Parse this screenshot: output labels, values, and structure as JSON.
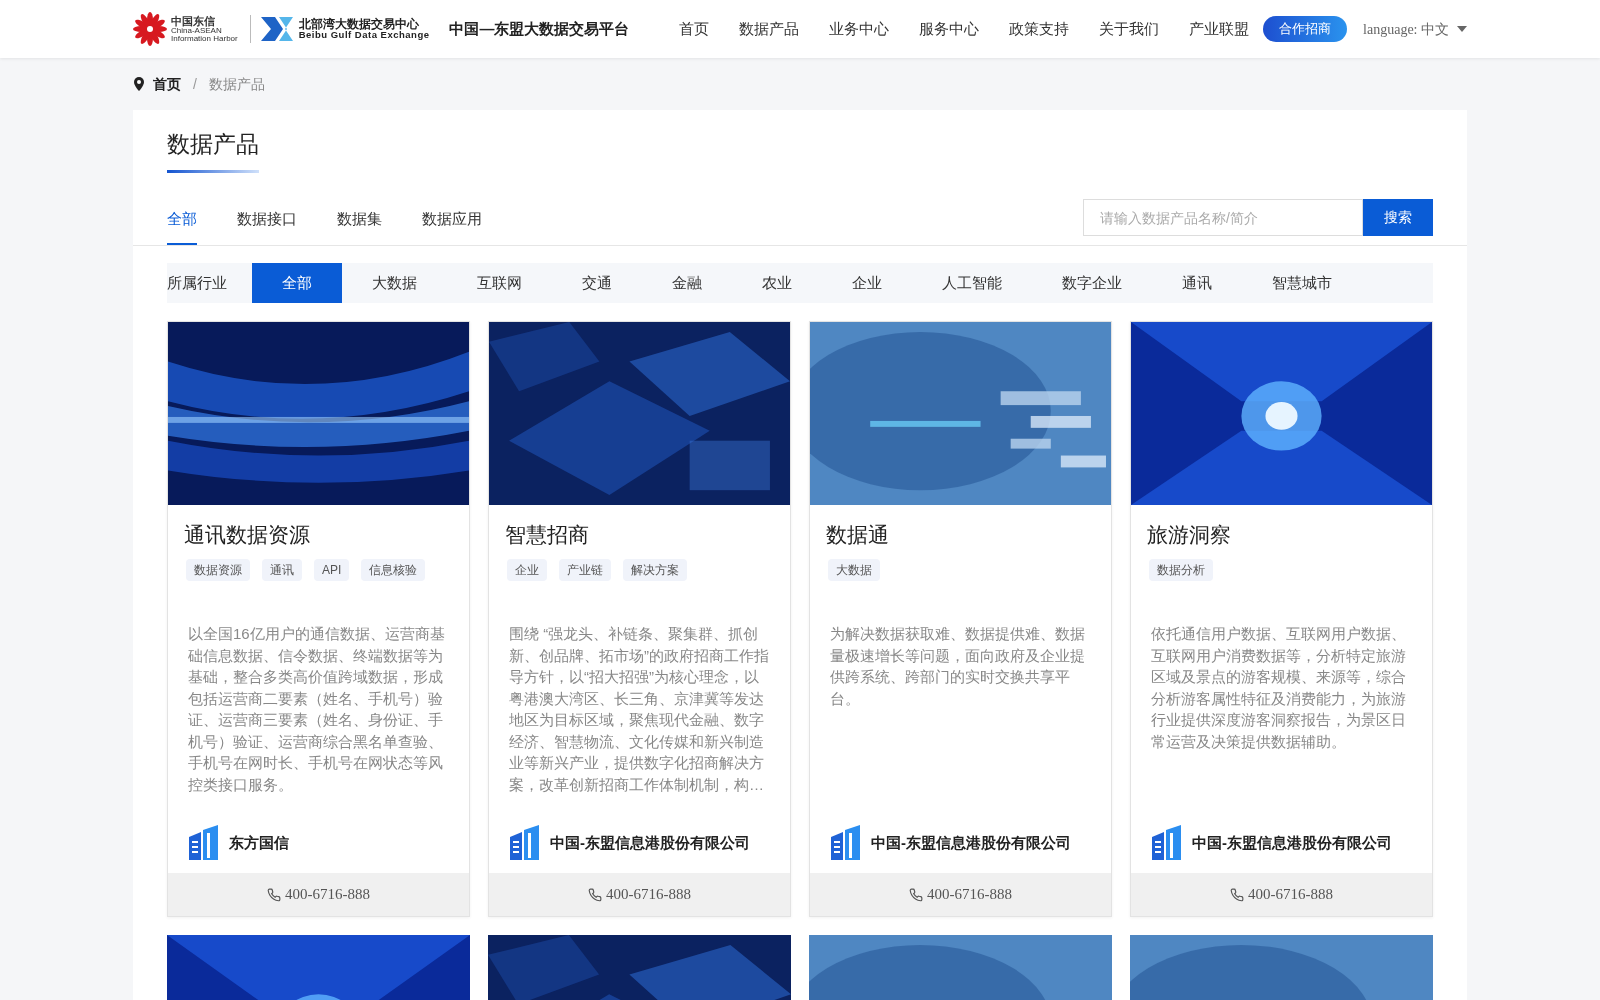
{
  "header": {
    "logos": [
      {
        "kind": "cn",
        "title": "中国东信",
        "subtitle": "China-ASEAN",
        "caption": "Information Harbor"
      },
      {
        "kind": "bg",
        "title": "北部湾大数据交易中心",
        "subtitle": "Beibu Gulf Data Exchange"
      },
      {
        "kind": "platform",
        "title": "中国—东盟大数据交易平台"
      }
    ],
    "nav": [
      "首页",
      "数据产品",
      "业务中心",
      "服务中心",
      "政策支持",
      "关于我们",
      "产业联盟"
    ],
    "cta": "合作招商",
    "language": "language: 中文"
  },
  "breadcrumb": {
    "items": [
      "首页",
      "数据产品"
    ],
    "separator": "/"
  },
  "page_title": "数据产品",
  "tabs": [
    {
      "label": "全部",
      "selected": true
    },
    {
      "label": "数据接口",
      "selected": false
    },
    {
      "label": "数据集",
      "selected": false
    },
    {
      "label": "数据应用",
      "selected": false
    }
  ],
  "search": {
    "placeholder": "请输入数据产品名称/简介",
    "button": "搜索"
  },
  "industry": {
    "label": "所属行业",
    "options": [
      {
        "label": "全部",
        "selected": true
      },
      {
        "label": "大数据",
        "selected": false
      },
      {
        "label": "互联网",
        "selected": false
      },
      {
        "label": "交通",
        "selected": false
      },
      {
        "label": "金融",
        "selected": false
      },
      {
        "label": "农业",
        "selected": false
      },
      {
        "label": "企业",
        "selected": false
      },
      {
        "label": "人工智能",
        "selected": false
      },
      {
        "label": "数字企业",
        "selected": false
      },
      {
        "label": "通讯",
        "selected": false
      },
      {
        "label": "智慧城市",
        "selected": false
      }
    ]
  },
  "cards": [
    {
      "title": "通讯数据资源",
      "tags": [
        "数据资源",
        "通讯",
        "API",
        "信息核验"
      ],
      "description": "以全国16亿用户的通信数据、运营商基础信息数据、信令数据、终端数据等为基础，整合多类高价值跨域数据，形成包括运营商二要素（姓名、手机号）验证、运营商三要素（姓名、身份证、手机号）验证、运营商综合黑名单查验、手机号在网时长、手机号在网状态等风控类接口服务。",
      "company": "东方国信",
      "phone": "400-6716-888"
    },
    {
      "title": "智慧招商",
      "tags": [
        "企业",
        "产业链",
        "解决方案"
      ],
      "description": "围绕 “强龙头、补链条、聚集群、抓创新、创品牌、拓市场”的政府招商工作指导方针，以“招大招强”为核心理念，以粤港澳大湾区、长三角、京津冀等发达地区为目标区域，聚焦现代金融、数字经济、智慧物流、文化传媒和新兴制造业等新兴产业，提供数字化招商解决方案，改革创新招商工作体制机制，构…",
      "company": "中国-东盟信息港股份有限公司",
      "phone": "400-6716-888"
    },
    {
      "title": "数据通",
      "tags": [
        "大数据"
      ],
      "description": "为解决数据获取难、数据提供难、数据量极速增长等问题，面向政府及企业提供跨系统、跨部门的实时交换共享平台。",
      "company": "中国-东盟信息港股份有限公司",
      "phone": "400-6716-888"
    },
    {
      "title": "旅游洞察",
      "tags": [
        "数据分析"
      ],
      "description": "依托通信用户数据、互联网用户数据、互联网用户消费数据等，分析特定旅游区域及景点的游客规模、来源等，综合分析游客属性特征及消费能力，为旅游行业提供深度游客洞察报告，为景区日常运营及决策提供数据辅助。",
      "company": "中国-东盟信息港股份有限公司",
      "phone": "400-6716-888"
    }
  ]
}
